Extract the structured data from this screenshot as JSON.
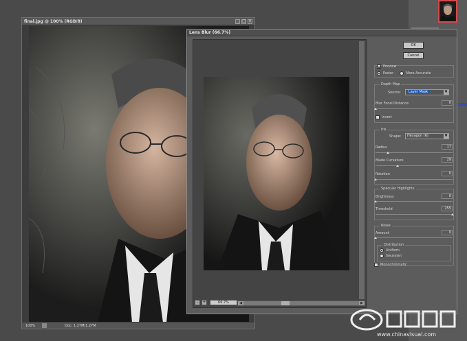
{
  "document": {
    "title": "final.jpg @ 100% (RGB/8)",
    "status_zoom": "100%",
    "status_doc": "Doc: 1.27M/1.27M",
    "win_btns": [
      "_",
      "□",
      "×"
    ]
  },
  "dialog": {
    "title": "Lens Blur (66.7%)",
    "ok_label": "OK",
    "cancel_label": "Cancel",
    "preview_label": "Preview",
    "faster_label": "Faster",
    "more_accurate_label": "More Accurate",
    "preview_zoom": "66.7%",
    "zoom_minus": "-",
    "zoom_plus": "+",
    "scroll_left": "◀",
    "scroll_right": "▶",
    "depth_map": {
      "group_label": "Depth Map",
      "source_label": "Source:",
      "source_value": "Layer Mask",
      "focal_label": "Blur Focal Distance",
      "focal_value": "0",
      "invert_label": "Invert"
    },
    "iris": {
      "group_label": "Iris",
      "shape_label": "Shape:",
      "shape_value": "Hexagon (6)",
      "radius_label": "Radius",
      "radius_value": "17",
      "curvature_label": "Blade Curvature",
      "curvature_value": "29",
      "rotation_label": "Rotation",
      "rotation_value": "0"
    },
    "specular": {
      "group_label": "Specular Highlights",
      "brightness_label": "Brightness",
      "brightness_value": "0",
      "threshold_label": "Threshold",
      "threshold_value": "255"
    },
    "noise": {
      "group_label": "Noise",
      "amount_label": "Amount",
      "amount_value": "0",
      "distribution_label": "Distribution",
      "uniform_label": "Uniform",
      "gaussian_label": "Gaussian",
      "monochromatic_label": "Monochromatic"
    }
  },
  "watermark": {
    "text": "www.chinavisual.com"
  },
  "colors": {
    "background": "#4a4a4a",
    "accent_select": "#2255aa",
    "palette_highlight": "#d24b4b"
  }
}
